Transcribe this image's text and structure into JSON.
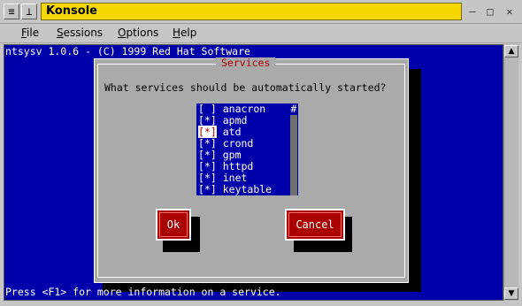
{
  "window": {
    "title": "Konsole",
    "controls": {
      "menu": "≡",
      "pin": "⊥",
      "minimize": "–",
      "maximize": "□",
      "close": "✕"
    }
  },
  "menubar": {
    "items": [
      {
        "label": "File",
        "accel": "F",
        "rest": "ile"
      },
      {
        "label": "Sessions",
        "accel": "S",
        "rest": "essions"
      },
      {
        "label": "Options",
        "accel": "O",
        "rest": "ptions"
      },
      {
        "label": "Help",
        "accel": "H",
        "rest": "elp"
      }
    ]
  },
  "terminal": {
    "header": "ntsysv 1.0.6 - (C) 1999 Red Hat Software",
    "status": "Press <F1> for more information on a service."
  },
  "dialog": {
    "title": "Services",
    "prompt": "What services should be automatically started?",
    "services": [
      {
        "mark": "[ ]",
        "name": "anacron"
      },
      {
        "mark": "[*]",
        "name": "apmd"
      },
      {
        "mark": "[*]",
        "name": "atd"
      },
      {
        "mark": "[*]",
        "name": "crond"
      },
      {
        "mark": "[*]",
        "name": "gpm"
      },
      {
        "mark": "[*]",
        "name": "httpd"
      },
      {
        "mark": "[*]",
        "name": "inet"
      },
      {
        "mark": "[*]",
        "name": "keytable"
      }
    ],
    "focused_index": 2,
    "scroll_marker": "#",
    "ok_label": "Ok",
    "cancel_label": "Cancel"
  },
  "colors": {
    "terminal_bg": "#0000aa",
    "dialog_bg": "#aaaaaa",
    "button_bg": "#aa0000",
    "title_strip": "#f5d800"
  }
}
